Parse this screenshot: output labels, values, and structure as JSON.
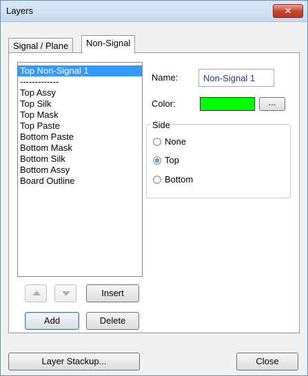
{
  "window": {
    "title": "Layers",
    "close_glyph": "✕"
  },
  "tabs": [
    {
      "label": "Signal / Plane",
      "active": false
    },
    {
      "label": "Non-Signal",
      "active": true
    }
  ],
  "layers_list": {
    "items": [
      "Top Non-Signal 1",
      "-------------",
      "Top Assy",
      "Top Silk",
      "Top Mask",
      "Top Paste",
      "Bottom Paste",
      "Bottom Mask",
      "Bottom Silk",
      "Bottom Assy",
      "Board Outline"
    ],
    "selected_index": 0
  },
  "properties": {
    "name_label": "Name:",
    "name_value": "Non-Signal 1",
    "color_label": "Color:",
    "color_value": "#00ff00",
    "color_button_label": "...",
    "side_group_label": "Side",
    "side_options": [
      "None",
      "Top",
      "Bottom"
    ],
    "side_selected": "Top"
  },
  "list_buttons": {
    "move_up_icon": "arrow-up-icon",
    "move_down_icon": "arrow-down-icon",
    "insert_label": "Insert",
    "add_label": "Add",
    "delete_label": "Delete"
  },
  "footer": {
    "layer_stackup_label": "Layer Stackup...",
    "close_label": "Close"
  }
}
